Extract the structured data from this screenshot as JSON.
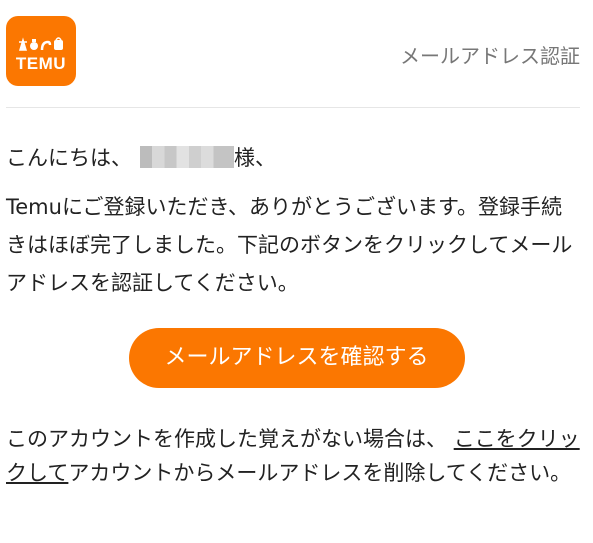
{
  "header": {
    "logo_text": "TEMU",
    "title": "メールアドレス認証"
  },
  "greeting": {
    "prefix": "こんにちは、",
    "suffix": "様、"
  },
  "body": {
    "text": "Temuにご登録いただき、ありがとうございます。登録手続きはほぼ完了しました。下記のボタンをクリックしてメールアドレスを認証してください。"
  },
  "cta": {
    "label": "メールアドレスを確認する"
  },
  "footer": {
    "prefix": "このアカウントを作成した覚えがない場合は、",
    "link": "ここをクリックして",
    "suffix": "アカウントからメールアドレスを削除してください。"
  },
  "colors": {
    "brand": "#fb7701",
    "header_title": "#777777",
    "text": "#222222"
  }
}
